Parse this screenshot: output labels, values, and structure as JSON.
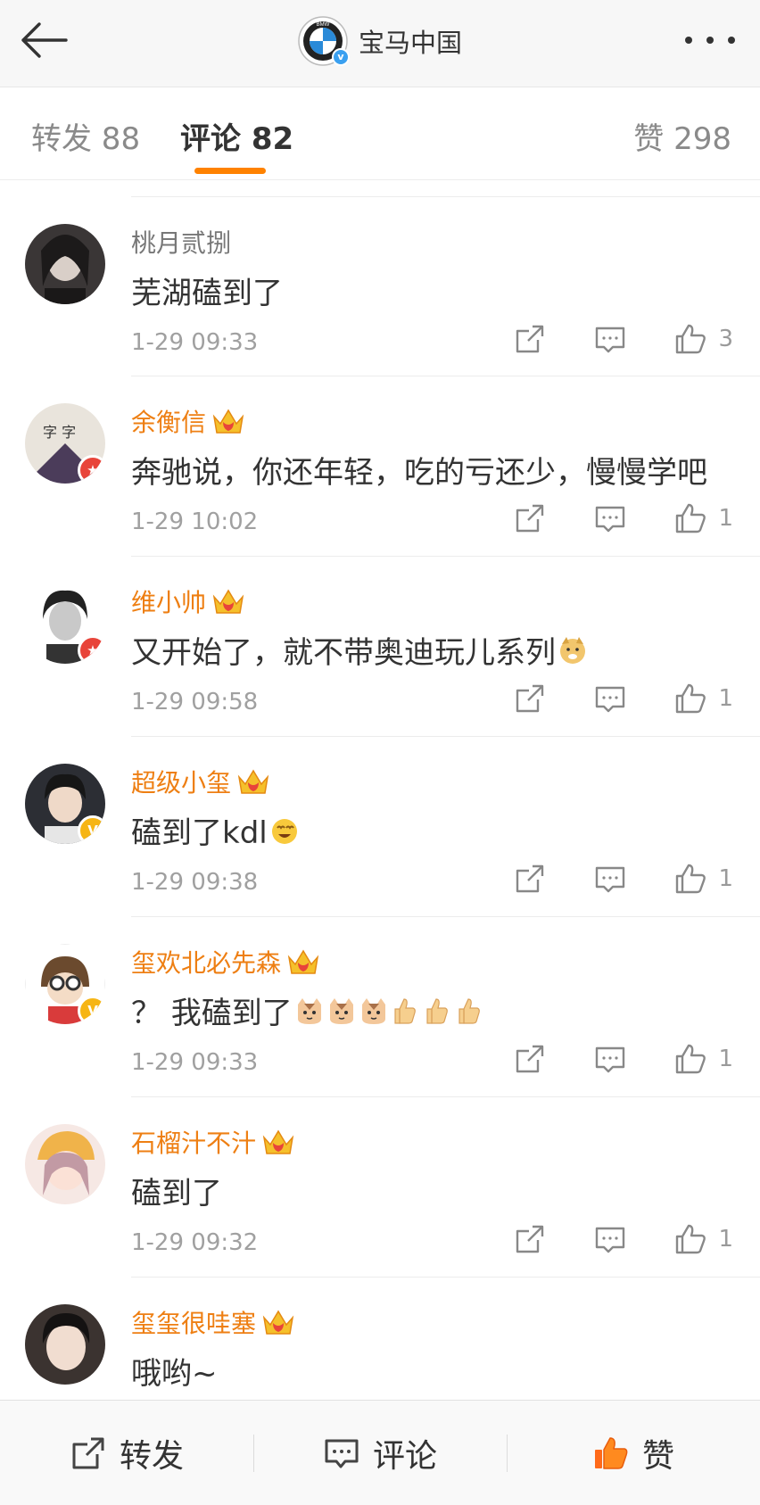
{
  "header": {
    "title": "宝马中国",
    "logo_text": "BMW"
  },
  "tabs": [
    {
      "label": "转发 88"
    },
    {
      "label": "评论 82"
    },
    {
      "label": "赞 298"
    }
  ],
  "comments": [
    {
      "name": "桃月贰捌",
      "text": "芜湖磕到了",
      "time": "1-29 09:33",
      "likes": "3",
      "vip": false
    },
    {
      "name": "余衡信",
      "text": "奔驰说，你还年轻，吃的亏还少，慢慢学吧",
      "time": "1-29 10:02",
      "likes": "1",
      "vip": true,
      "badge": "red"
    },
    {
      "name": "维小帅",
      "text": "又开始了，就不带奥迪玩儿系列",
      "time": "1-29 09:58",
      "likes": "1",
      "vip": true,
      "badge": "red"
    },
    {
      "name": "超级小玺",
      "text": "磕到了kdl",
      "time": "1-29 09:38",
      "likes": "1",
      "vip": true,
      "badge": "gold"
    },
    {
      "name": "玺欢北必先森",
      "text": "？ 我磕到了",
      "time": "1-29 09:33",
      "likes": "1",
      "vip": true,
      "badge": "gold"
    },
    {
      "name": "石榴汁不汁",
      "text": "磕到了",
      "time": "1-29 09:32",
      "likes": "1",
      "vip": true
    },
    {
      "name": "玺玺很哇塞",
      "text": "哦哟~",
      "time": "",
      "likes": "",
      "vip": true
    }
  ],
  "bottom_bar": {
    "repost": "转发",
    "comment": "评论",
    "like": "赞"
  },
  "colors": {
    "accent": "#ff8200",
    "vip_name": "#ee7f13",
    "verify_blue": "#3aa0f0"
  }
}
